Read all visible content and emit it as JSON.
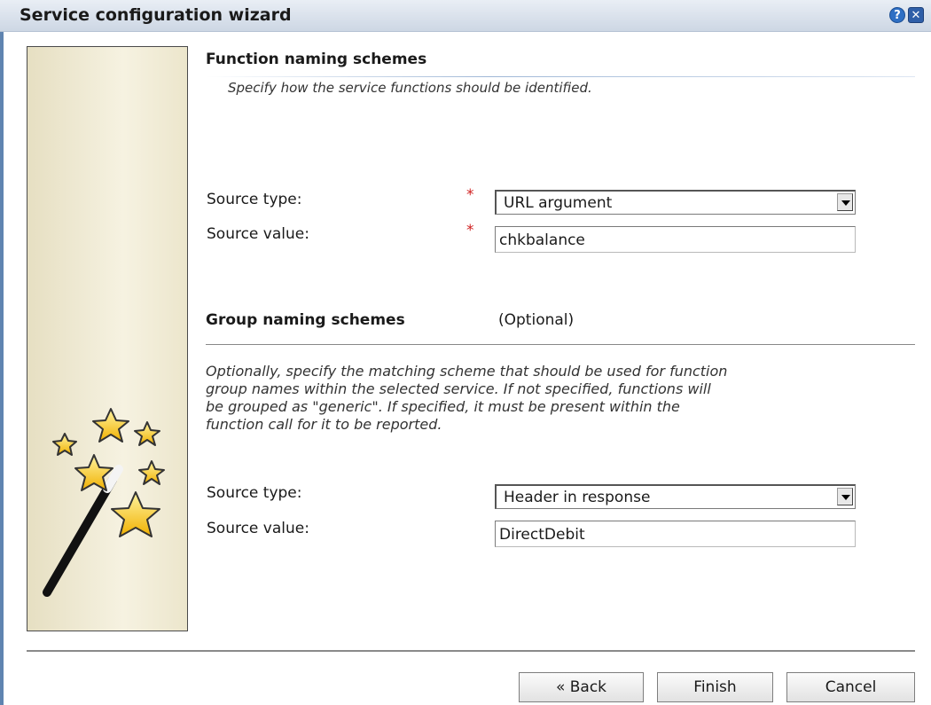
{
  "window": {
    "title": "Service configuration wizard",
    "help_glyph": "?",
    "close_glyph": "✕"
  },
  "function_naming": {
    "heading": "Function naming schemes",
    "description": "Specify how the service functions should be identified.",
    "source_type_label": "Source type:",
    "source_type_value": "URL argument",
    "source_value_label": "Source value:",
    "source_value_value": "chkbalance",
    "required_marker": "*"
  },
  "group_naming": {
    "heading": "Group naming schemes",
    "optional_label": "(Optional)",
    "description_lines": [
      "Optionally, specify the matching scheme that should be used for function",
      "group names within the selected service. If not specified, functions will",
      "be grouped as \"generic\". If specified, it must be present within the",
      "function call for it to be reported."
    ],
    "source_type_label": "Source type:",
    "source_type_value": "Header in response",
    "source_value_label": "Source value:",
    "source_value_value": "DirectDebit"
  },
  "buttons": {
    "back": "« Back",
    "finish": "Finish",
    "cancel": "Cancel"
  },
  "colors": {
    "accent": "#2e6fc4",
    "required": "#d02020",
    "title_bar": "#cdd7e4"
  }
}
